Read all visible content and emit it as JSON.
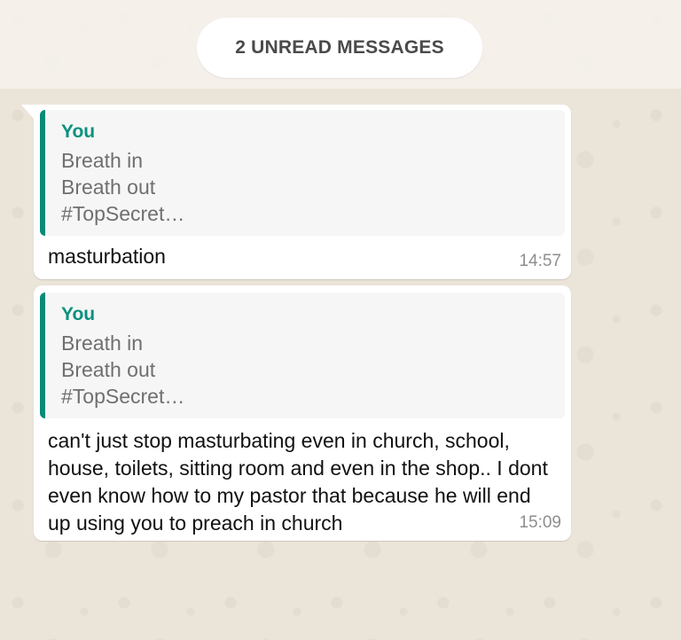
{
  "unread_banner": "2 UNREAD MESSAGES",
  "messages": [
    {
      "quote_author": "You",
      "quote_lines": [
        "Breath in",
        "Breath out",
        "#TopSecret…"
      ],
      "text": "masturbation",
      "time": "14:57"
    },
    {
      "quote_author": "You",
      "quote_lines": [
        "Breath in",
        "Breath out",
        "#TopSecret…"
      ],
      "text": "can't just stop masturbating even in church, school, house, toilets, sitting room and even in the shop.. I dont even know how to my pastor that because he will end up using you to preach in church",
      "time": "15:09"
    }
  ],
  "colors": {
    "quote_accent": "#058b78",
    "quote_author": "#07917d",
    "background": "#ebe4d9",
    "bubble": "#ffffff"
  }
}
